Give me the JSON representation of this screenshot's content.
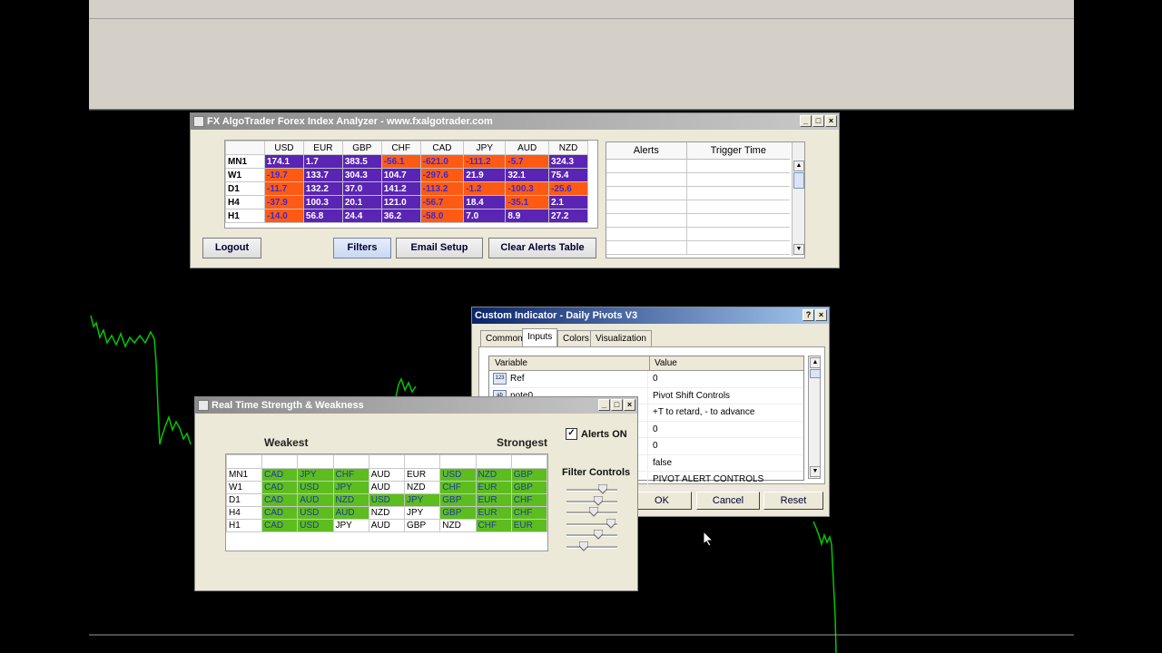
{
  "colors": {
    "positive": "#5a24b4",
    "negative": "#ff5a14",
    "strength_cell": "#5dbd1e",
    "chart_line": "#00c800"
  },
  "fx_window": {
    "title": "FX AlgoTrader Forex Index Analyzer - www.fxalgotrader.com",
    "columns": [
      "USD",
      "EUR",
      "GBP",
      "CHF",
      "CAD",
      "JPY",
      "AUD",
      "NZD"
    ],
    "rows": [
      {
        "label": "MN1",
        "values": [
          "174.1",
          "1.7",
          "383.5",
          "-56.1",
          "-621.0",
          "-111.2",
          "-5.7",
          "324.3"
        ],
        "neg": [
          0,
          0,
          0,
          1,
          1,
          1,
          1,
          0
        ]
      },
      {
        "label": "W1",
        "values": [
          "-19.7",
          "133.7",
          "304.3",
          "104.7",
          "-297.6",
          "21.9",
          "32.1",
          "75.4"
        ],
        "neg": [
          1,
          0,
          0,
          0,
          1,
          0,
          0,
          0
        ]
      },
      {
        "label": "D1",
        "values": [
          "-11.7",
          "132.2",
          "37.0",
          "141.2",
          "-113.2",
          "-1.2",
          "-100.3",
          "-25.6"
        ],
        "neg": [
          1,
          0,
          0,
          0,
          1,
          1,
          1,
          1
        ]
      },
      {
        "label": "H4",
        "values": [
          "-37.9",
          "100.3",
          "20.1",
          "121.0",
          "-56.7",
          "18.4",
          "-35.1",
          "2.1"
        ],
        "neg": [
          1,
          0,
          0,
          0,
          1,
          0,
          1,
          0
        ]
      },
      {
        "label": "H1",
        "values": [
          "-14.0",
          "56.8",
          "24.4",
          "36.2",
          "-58.0",
          "7.0",
          "8.9",
          "27.2"
        ],
        "neg": [
          1,
          0,
          0,
          0,
          1,
          0,
          0,
          0
        ]
      }
    ],
    "buttons": {
      "logout": "Logout",
      "filters": "Filters",
      "email": "Email Setup",
      "clear": "Clear Alerts Table"
    },
    "alerts_table": {
      "col_alerts": "Alerts",
      "col_trigger": "Trigger Time"
    }
  },
  "pivots_dialog": {
    "title": "Custom Indicator - Daily Pivots V3",
    "help_btn": "?",
    "close_btn": "×",
    "tabs": [
      "Common",
      "Inputs",
      "Colors",
      "Visualization"
    ],
    "selected_tab": "Inputs",
    "col_variable": "Variable",
    "col_value": "Value",
    "rows": [
      {
        "icon": "123",
        "variable": "Ref",
        "value": "0"
      },
      {
        "icon": "ab",
        "variable": "note0",
        "value": "Pivot Shift Controls"
      },
      {
        "icon": "",
        "variable": "",
        "value": "+T to retard, - to advance"
      },
      {
        "icon": "",
        "variable": "",
        "value": "0"
      },
      {
        "icon": "",
        "variable": "",
        "value": "0"
      },
      {
        "icon": "",
        "variable": "",
        "value": "false"
      },
      {
        "icon": "",
        "variable": "",
        "value": "PIVOT ALERT CONTROLS"
      }
    ],
    "buttons": {
      "ok": "OK",
      "cancel": "Cancel",
      "reset": "Reset"
    }
  },
  "strength_window": {
    "title": "Real Time Strength & Weakness",
    "weakest": "Weakest",
    "strongest": "Strongest",
    "alerts_on": "Alerts ON",
    "alerts_checked": true,
    "filter_controls": "Filter Controls",
    "slider_levels": [
      0.75,
      0.65,
      0.55,
      0.95,
      0.65,
      0.3
    ],
    "rows": [
      {
        "label": "MN1",
        "cells": [
          "CAD",
          "JPY",
          "CHF",
          "AUD",
          "EUR",
          "USD",
          "NZD",
          "GBP"
        ],
        "green": [
          1,
          1,
          1,
          0,
          0,
          1,
          1,
          1
        ]
      },
      {
        "label": "W1",
        "cells": [
          "CAD",
          "USD",
          "JPY",
          "AUD",
          "NZD",
          "CHF",
          "EUR",
          "GBP"
        ],
        "green": [
          1,
          1,
          1,
          0,
          0,
          1,
          1,
          1
        ]
      },
      {
        "label": "D1",
        "cells": [
          "CAD",
          "AUD",
          "NZD",
          "USD",
          "JPY",
          "GBP",
          "EUR",
          "CHF"
        ],
        "green": [
          1,
          1,
          1,
          1,
          1,
          1,
          1,
          1
        ]
      },
      {
        "label": "H4",
        "cells": [
          "CAD",
          "USD",
          "AUD",
          "NZD",
          "JPY",
          "GBP",
          "EUR",
          "CHF"
        ],
        "green": [
          1,
          1,
          1,
          0,
          0,
          1,
          1,
          1
        ]
      },
      {
        "label": "H1",
        "cells": [
          "CAD",
          "USD",
          "JPY",
          "AUD",
          "GBP",
          "NZD",
          "CHF",
          "EUR"
        ],
        "green": [
          1,
          1,
          0,
          0,
          0,
          0,
          1,
          1
        ]
      }
    ]
  }
}
